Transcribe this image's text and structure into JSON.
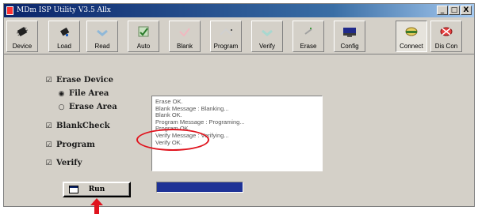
{
  "window": {
    "title": "MDm ISP Utility V3.5 Allx",
    "controls": {
      "minimize": "_",
      "maximize": "□",
      "close": "X"
    }
  },
  "toolbar": {
    "buttons": [
      {
        "label": "Device",
        "icon": "chip-icon"
      },
      {
        "label": "Load",
        "icon": "load-icon"
      },
      {
        "label": "Read",
        "icon": "read-icon"
      },
      {
        "label": "Auto",
        "icon": "auto-icon"
      },
      {
        "label": "Blank",
        "icon": "blank-icon"
      },
      {
        "label": "Program",
        "icon": "program-icon"
      },
      {
        "label": "Verify",
        "icon": "verify-icon"
      },
      {
        "label": "Erase",
        "icon": "erase-icon"
      },
      {
        "label": "Config",
        "icon": "config-icon"
      },
      {
        "label": "Connect",
        "icon": "connect-icon",
        "active": true
      },
      {
        "label": "Dis Con",
        "icon": "disconnect-icon"
      }
    ]
  },
  "options": {
    "erase_device": {
      "label": "Erase Device",
      "checked": true
    },
    "file_area": {
      "label": "File Area",
      "selected": true
    },
    "erase_area": {
      "label": "Erase Area",
      "selected": false
    },
    "blank_check": {
      "label": "BlankCheck",
      "checked": true
    },
    "program": {
      "label": "Program",
      "checked": true
    },
    "verify": {
      "label": "Verify",
      "checked": true
    }
  },
  "log": {
    "lines": [
      "Erase OK.",
      "Blank Message : Blanking...",
      "Blank OK.",
      "Program Message : Programing...",
      "Program OK.",
      "Verify Message : Verifying...",
      "Verify OK."
    ]
  },
  "run_button": {
    "label": "Run"
  },
  "progress": {
    "percent": 100
  },
  "colors": {
    "titlebar": "#0a246a",
    "progress_fill": "#1e3296",
    "annotation": "#e0141e",
    "window_bg": "#d4d0c8"
  }
}
